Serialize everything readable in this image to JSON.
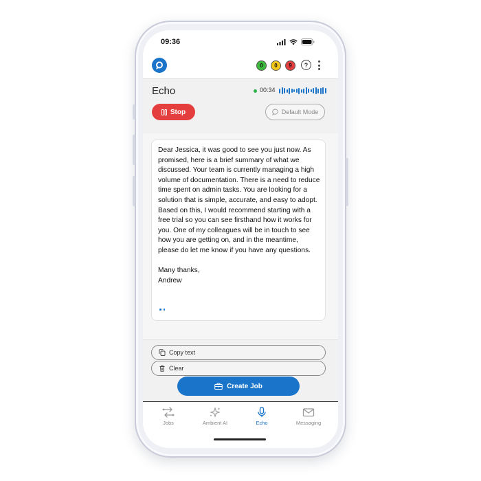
{
  "status_bar": {
    "time": "09:36"
  },
  "app_bar": {
    "badges": [
      {
        "name": "badge-green",
        "count": "0",
        "color": "#3dbb3d"
      },
      {
        "name": "badge-yellow",
        "count": "0",
        "color": "#f2c918"
      },
      {
        "name": "badge-red",
        "count": "9",
        "color": "#e53e3e"
      }
    ],
    "help_label": "?"
  },
  "echo": {
    "title": "Echo",
    "timer": "00:34",
    "stop_label": "Stop",
    "mode_label": "Default Mode"
  },
  "letter": {
    "paragraph": "Dear Jessica, it was good to see you just now. As promised, here is a brief summary of what we discussed. Your team is currently managing a high volume of documentation. There is a need to reduce time spent on admin tasks. You are looking for a solution that is simple, accurate, and easy to adopt. Based on this, I would recommend starting with a free trial so you can see firsthand how it works for you. One of my colleagues will be in touch to see how you are getting on, and in the meantime, please do let me know if you have any questions.",
    "signoff": "Many thanks,",
    "signature": "Andrew"
  },
  "actions": {
    "copy_label": "Copy text",
    "clear_label": "Clear",
    "create_label": "Create Job"
  },
  "nav": {
    "items": [
      {
        "label": "Jobs",
        "icon": "jobs-icon",
        "active": false
      },
      {
        "label": "Ambient AI",
        "icon": "sparkle-icon",
        "active": false
      },
      {
        "label": "Echo",
        "icon": "microphone-icon",
        "active": true
      },
      {
        "label": "Messaging",
        "icon": "envelope-icon",
        "active": false
      }
    ]
  },
  "colors": {
    "accent": "#1a74c9",
    "stop": "#e53e3e",
    "recording": "#2bb34a"
  }
}
